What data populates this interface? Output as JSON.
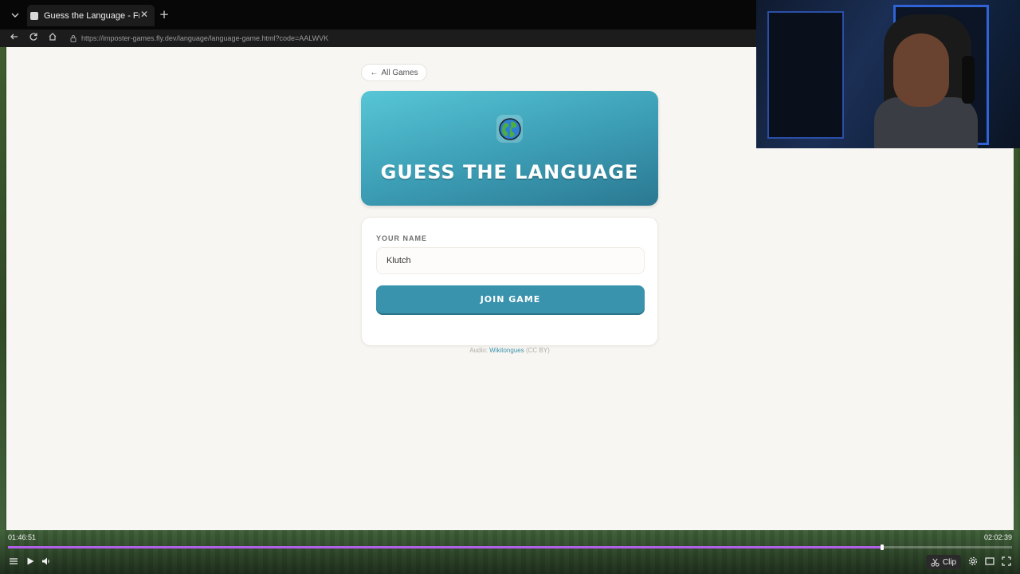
{
  "browser": {
    "tab_title": "Guess the Language - Free Online",
    "url": "https://imposter-games.fly.dev/language/language-game.html?code=AALWVK",
    "icons": {
      "tab_list": "chevron-down-icon",
      "close": "close-icon",
      "new_tab": "plus-icon",
      "back": "arrow-left-icon",
      "reload": "reload-icon",
      "home": "home-icon",
      "lock": "lock-icon"
    }
  },
  "page": {
    "back_label": "All Games",
    "back_arrow": "←",
    "hero": {
      "icon": "globe-icon",
      "title": "GUESS THE LANGUAGE",
      "colors": {
        "gradient_start": "#57c6d6",
        "gradient_end": "#2b7892"
      }
    },
    "join": {
      "name_label": "YOUR NAME",
      "name_value": "Klutch",
      "button_label": "JOIN GAME",
      "accent_color": "#3a93ad"
    },
    "attribution": {
      "prefix": "Audio:",
      "link": "Wikitongues",
      "suffix": "(CC BY)"
    }
  },
  "player": {
    "current_time": "01:46:51",
    "total_time": "02:02:39",
    "progress_fraction": 0.871,
    "clip_label": "Clip",
    "progress_color": "#b061e8",
    "icons": [
      "menu-icon",
      "play-icon",
      "volume-icon",
      "scissors-icon",
      "gear-icon",
      "theater-mode-icon",
      "fullscreen-icon"
    ]
  }
}
